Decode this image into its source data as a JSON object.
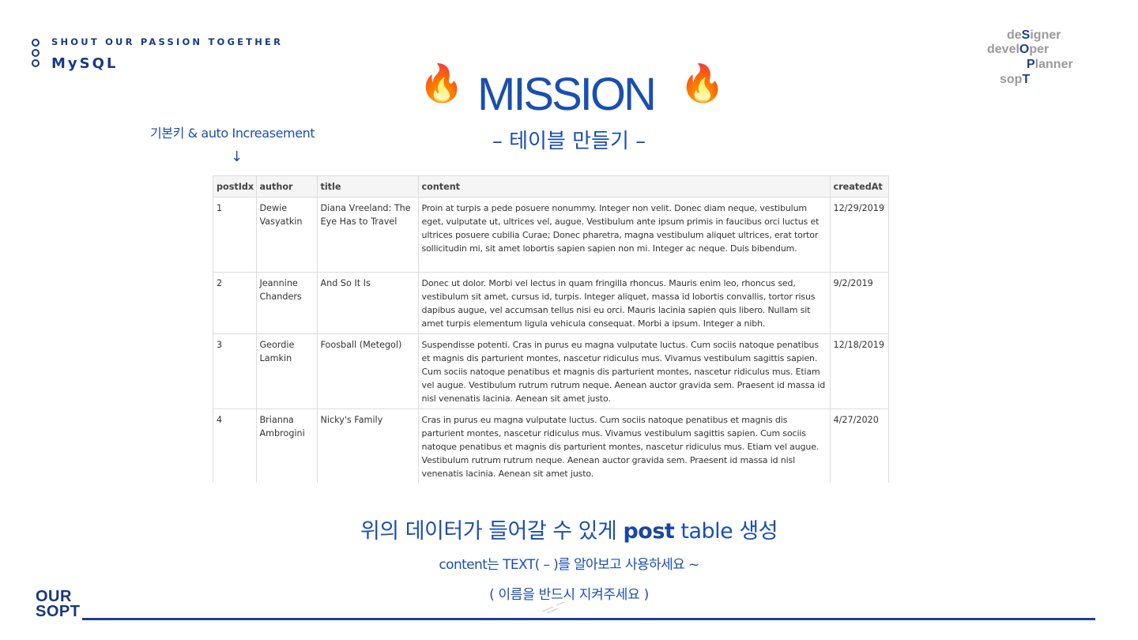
{
  "brand": {
    "tagline": "SHOUT OUR PASSION TOGETHER",
    "course": "MySQL"
  },
  "roles": {
    "line1_pre": "de",
    "line1_hl": "S",
    "line1_post": "igner",
    "line2_pre": "devel",
    "line2_hl": "O",
    "line2_post": "per",
    "line3_hl": "P",
    "line3_post": "lanner",
    "line4_pre": "sop",
    "line4_hl": "T"
  },
  "heading": {
    "emoji": "🔥",
    "title": "MISSION",
    "subtitle": "– 테이블 만들기 –"
  },
  "annotation": {
    "note": "기본키 & auto Increasement",
    "arrow": "↓"
  },
  "table": {
    "columns": [
      "postIdx",
      "author",
      "title",
      "content",
      "createdAt"
    ],
    "rows": [
      {
        "postIdx": "1",
        "author": "Dewie Vasyatkin",
        "title": "Diana Vreeland: The Eye Has to Travel",
        "content": "Proin at turpis a pede posuere nonummy. Integer non velit. Donec diam neque, vestibulum eget, vulputate ut, ultrices vel, augue. Vestibulum ante ipsum primis in faucibus orci luctus et ultrices posuere cubilia Curae; Donec pharetra, magna vestibulum aliquet ultrices, erat tortor sollicitudin mi, sit amet lobortis sapien sapien non mi. Integer ac neque. Duis bibendum.",
        "createdAt": "12/29/2019"
      },
      {
        "postIdx": "2",
        "author": "Jeannine Chanders",
        "title": "And So It Is",
        "content": "Donec ut dolor. Morbi vel lectus in quam fringilla rhoncus. Mauris enim leo, rhoncus sed, vestibulum sit amet, cursus id, turpis. Integer aliquet, massa id lobortis convallis, tortor risus dapibus augue, vel accumsan tellus nisi eu orci. Mauris lacinia sapien quis libero. Nullam sit amet turpis elementum ligula vehicula consequat. Morbi a ipsum. Integer a nibh.",
        "createdAt": "9/2/2019"
      },
      {
        "postIdx": "3",
        "author": "Geordie Lamkin",
        "title": "Foosball (Metegol)",
        "content": "Suspendisse potenti. Cras in purus eu magna vulputate luctus. Cum sociis natoque penatibus et magnis dis parturient montes, nascetur ridiculus mus. Vivamus vestibulum sagittis sapien. Cum sociis natoque penatibus et magnis dis parturient montes, nascetur ridiculus mus. Etiam vel augue. Vestibulum rutrum rutrum neque. Aenean auctor gravida sem. Praesent id massa id nisl venenatis lacinia. Aenean sit amet justo.",
        "createdAt": "12/18/2019"
      },
      {
        "postIdx": "4",
        "author": "Brianna Ambrogini",
        "title": "Nicky's Family",
        "content": "Cras in purus eu magna vulputate luctus. Cum sociis natoque penatibus et magnis dis parturient montes, nascetur ridiculus mus. Vivamus vestibulum sagittis sapien. Cum sociis natoque penatibus et magnis dis parturient montes, nascetur ridiculus mus. Etiam vel augue. Vestibulum rutrum rutrum neque. Aenean auctor gravida sem. Praesent id massa id nisl venenatis lacinia. Aenean sit amet justo.",
        "createdAt": "4/27/2020"
      }
    ]
  },
  "instructions": {
    "main_pre": "위의 데이터가 들어갈 수 있게 ",
    "main_strong": "post",
    "main_post": " table 생성",
    "hint1": "content는 TEXT( – )를 알아보고 사용하세요 ~",
    "hint2": "( 이름을 반드시 지켜주세요 )"
  },
  "logo": {
    "line1": "OUR",
    "line2": "SOPT"
  },
  "colors": {
    "primary": "#1a4fb0",
    "navy": "#1d3f93",
    "gray": "#9a9a9a"
  }
}
